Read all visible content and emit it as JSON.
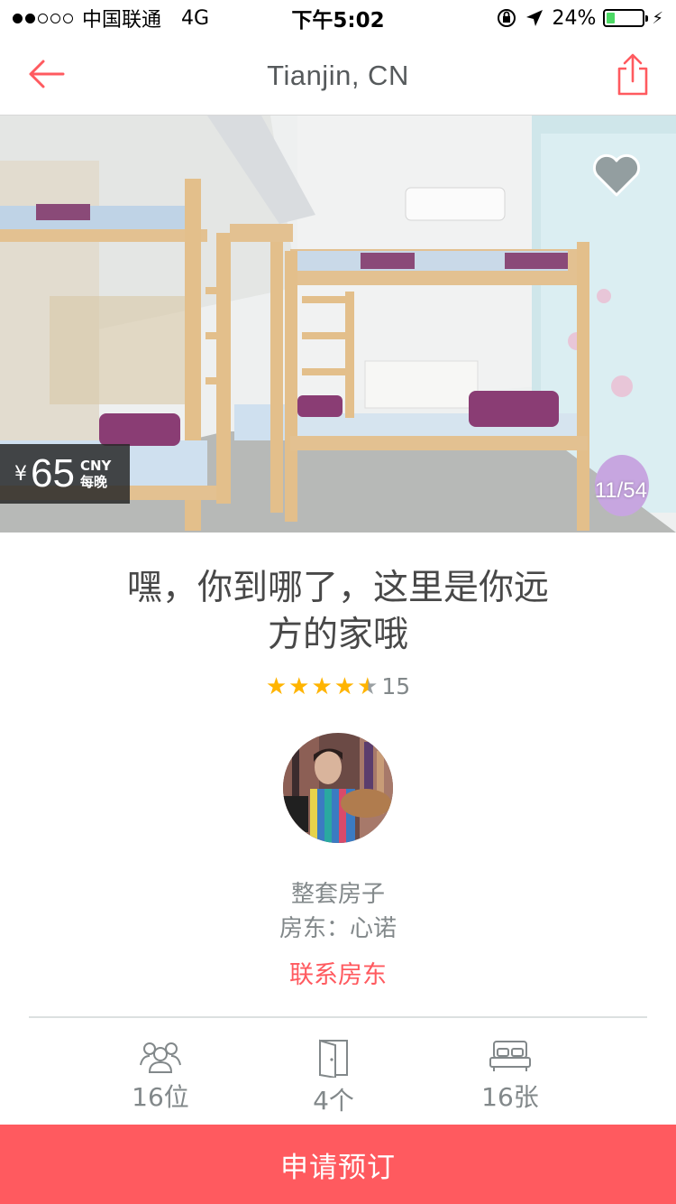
{
  "status_bar": {
    "carrier": "中国联通",
    "network": "4G",
    "time": "下午5:02",
    "battery_percent": "24%",
    "battery_level": 0.24
  },
  "nav": {
    "title": "Tianjin, CN"
  },
  "hero": {
    "currency_symbol": "¥",
    "price": "65",
    "currency_code": "CNY",
    "price_period": "每晚",
    "photo_counter": "11/54"
  },
  "listing": {
    "title_line1": "嘿，你到哪了，这里是你远",
    "title_line2": "方的家哦",
    "rating": 4.5,
    "review_count": "15",
    "room_type": "整套房子",
    "host": "房东：心诺",
    "contact_label": "联系房东"
  },
  "amenities": [
    {
      "icon": "guests-icon",
      "label": "16位"
    },
    {
      "icon": "door-icon",
      "label": "4个"
    },
    {
      "icon": "bed-icon",
      "label": "16张"
    }
  ],
  "actions": {
    "book_label": "申请预订"
  },
  "colors": {
    "brand": "#ff5a5f",
    "star": "#ffb400",
    "text": "#484848",
    "muted": "#82888a"
  }
}
